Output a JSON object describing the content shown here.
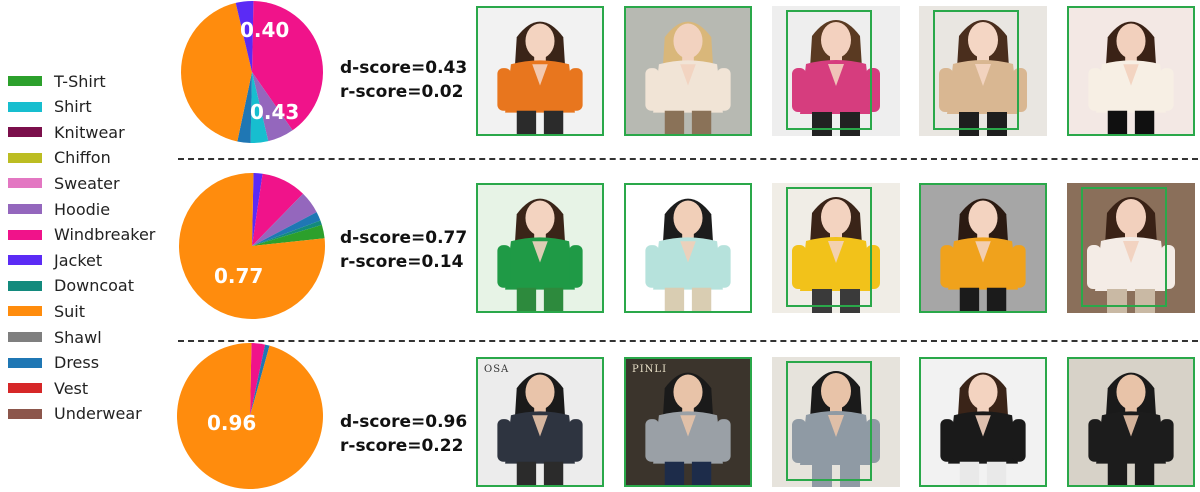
{
  "legend": [
    {
      "label": "T-Shirt",
      "color": "#2ca02c"
    },
    {
      "label": "Shirt",
      "color": "#17becf"
    },
    {
      "label": "Knitwear",
      "color": "#7b0f4b"
    },
    {
      "label": "Chiffon",
      "color": "#bcbd22"
    },
    {
      "label": "Sweater",
      "color": "#e377c2"
    },
    {
      "label": "Hoodie",
      "color": "#9467bd"
    },
    {
      "label": "Windbreaker",
      "color": "#f0138a"
    },
    {
      "label": "Jacket",
      "color": "#5b2bf5"
    },
    {
      "label": "Downcoat",
      "color": "#138a7d"
    },
    {
      "label": "Suit",
      "color": "#ff8c0d"
    },
    {
      "label": "Shawl",
      "color": "#7f7f7f"
    },
    {
      "label": "Dress",
      "color": "#1f77b4"
    },
    {
      "label": "Vest",
      "color": "#d62728"
    },
    {
      "label": "Underwear",
      "color": "#8c564b"
    }
  ],
  "chart_data": [
    {
      "type": "pie",
      "slices": [
        {
          "category": "Windbreaker",
          "value": 0.4,
          "color": "#f0138a"
        },
        {
          "category": "Hoodie",
          "value": 0.06,
          "color": "#9467bd"
        },
        {
          "category": "Shirt",
          "value": 0.04,
          "color": "#17becf"
        },
        {
          "category": "Dress",
          "value": 0.03,
          "color": "#1f77b4"
        },
        {
          "category": "Suit",
          "value": 0.43,
          "color": "#ff8c0d"
        },
        {
          "category": "Jacket",
          "value": 0.04,
          "color": "#5b2bf5"
        }
      ],
      "labels": [
        "0.40",
        "0.43"
      ],
      "d_score": "d-score=0.43",
      "r_score": "r-score=0.02"
    },
    {
      "type": "pie",
      "slices": [
        {
          "category": "Jacket",
          "value": 0.02,
          "color": "#5b2bf5"
        },
        {
          "category": "Windbreaker",
          "value": 0.1,
          "color": "#f0138a"
        },
        {
          "category": "Hoodie",
          "value": 0.05,
          "color": "#9467bd"
        },
        {
          "category": "Dress",
          "value": 0.02,
          "color": "#1f77b4"
        },
        {
          "category": "Downcoat",
          "value": 0.01,
          "color": "#138a7d"
        },
        {
          "category": "T-Shirt",
          "value": 0.03,
          "color": "#2ca02c"
        },
        {
          "category": "Suit",
          "value": 0.77,
          "color": "#ff8c0d"
        }
      ],
      "labels": [
        "0.77"
      ],
      "d_score": "d-score=0.77",
      "r_score": "r-score=0.14"
    },
    {
      "type": "pie",
      "slices": [
        {
          "category": "Windbreaker",
          "value": 0.03,
          "color": "#f0138a"
        },
        {
          "category": "Dress",
          "value": 0.01,
          "color": "#1f77b4"
        },
        {
          "category": "Suit",
          "value": 0.96,
          "color": "#ff8c0d"
        }
      ],
      "labels": [
        "0.96"
      ],
      "d_score": "d-score=0.96",
      "r_score": "r-score=0.22"
    }
  ],
  "image_rows": [
    {
      "images": [
        {
          "name": "orange-coat-photo",
          "framed": true,
          "bg": "#f2f2f2",
          "garment": "#e8761e",
          "skin": "#f3d3c0",
          "hair": "#3a2418",
          "pants": "#2b2b2b"
        },
        {
          "name": "cream-jacket-photo",
          "framed": true,
          "bg": "#b7b9b2",
          "garment": "#f1e4d6",
          "skin": "#f2d2bf",
          "hair": "#d9b77a",
          "pants": "#8a7258"
        },
        {
          "name": "pink-blazer-photo",
          "framed": false,
          "bg": "#eeeeee",
          "garment": "#d63d7e",
          "skin": "#f3d1bf",
          "hair": "#5a3a22",
          "pants": "#222222"
        },
        {
          "name": "beige-blazer-photo",
          "framed": false,
          "bg": "#e9e6e1",
          "garment": "#d9b792",
          "skin": "#f4d6c4",
          "hair": "#4a2e1d",
          "pants": "#1e1e1e"
        },
        {
          "name": "white-blazer-photo",
          "framed": true,
          "bg": "#f3e8e4",
          "garment": "#f7efe4",
          "skin": "#f2d0bd",
          "hair": "#3a2216",
          "pants": "#101010"
        }
      ]
    },
    {
      "images": [
        {
          "name": "green-blazer-photo",
          "framed": true,
          "bg": "#e7f3e6",
          "garment": "#1f9a46",
          "skin": "#f3d3c0",
          "hair": "#3a2418",
          "pants": "#2d8a3d"
        },
        {
          "name": "mint-blazer-photo",
          "framed": true,
          "bg": "#ffffff",
          "garment": "#b6e2dc",
          "skin": "#f1cfb8",
          "hair": "#1c1c1c",
          "pants": "#d9cdb2"
        },
        {
          "name": "yellow-blazer-photo",
          "framed": false,
          "bg": "#f0ede6",
          "garment": "#f2c21a",
          "skin": "#f3d3c0",
          "hair": "#3a2418",
          "pants": "#3a3a3a"
        },
        {
          "name": "amber-blazer-photo",
          "framed": true,
          "bg": "#a6a6a6",
          "garment": "#f0a21c",
          "skin": "#f3d3c0",
          "hair": "#2b1a12",
          "pants": "#1b1b1b"
        },
        {
          "name": "white-suit-stairs-photo",
          "framed": false,
          "bg": "#8a6f5a",
          "garment": "#f4ece6",
          "skin": "#f2d0bd",
          "hair": "#3a2216",
          "pants": "#c9b9a4"
        }
      ]
    },
    {
      "images": [
        {
          "name": "navy-suit-photo",
          "framed": true,
          "bg": "#ececec",
          "garment": "#2e3440",
          "skin": "#e9c4aa",
          "hair": "#1a1a1a",
          "pants": "#2b2b2b",
          "brand": "OSA"
        },
        {
          "name": "grey-tweed-suit-photo",
          "framed": true,
          "bg": "#3b342c",
          "garment": "#9aa0a6",
          "skin": "#e8c3a8",
          "hair": "#1a1a1a",
          "pants": "#1d2c4a",
          "brand": "PINLI",
          "brandLight": true
        },
        {
          "name": "grey-suit-sunglasses-photo",
          "framed": false,
          "bg": "#e6e3dc",
          "garment": "#8f9aa4",
          "skin": "#e8c3a8",
          "hair": "#1a1a1a",
          "pants": "#8f9aa4"
        },
        {
          "name": "black-blazer-photo",
          "framed": true,
          "bg": "#f2f2f2",
          "garment": "#1a1a1a",
          "skin": "#f3d3c0",
          "hair": "#3a2418",
          "pants": "#e9e9e9"
        },
        {
          "name": "black-suit-street-photo",
          "framed": true,
          "bg": "#d7d2c8",
          "garment": "#1c1c1c",
          "skin": "#e8c3a8",
          "hair": "#1a1a1a",
          "pants": "#1c1c1c"
        }
      ]
    }
  ]
}
